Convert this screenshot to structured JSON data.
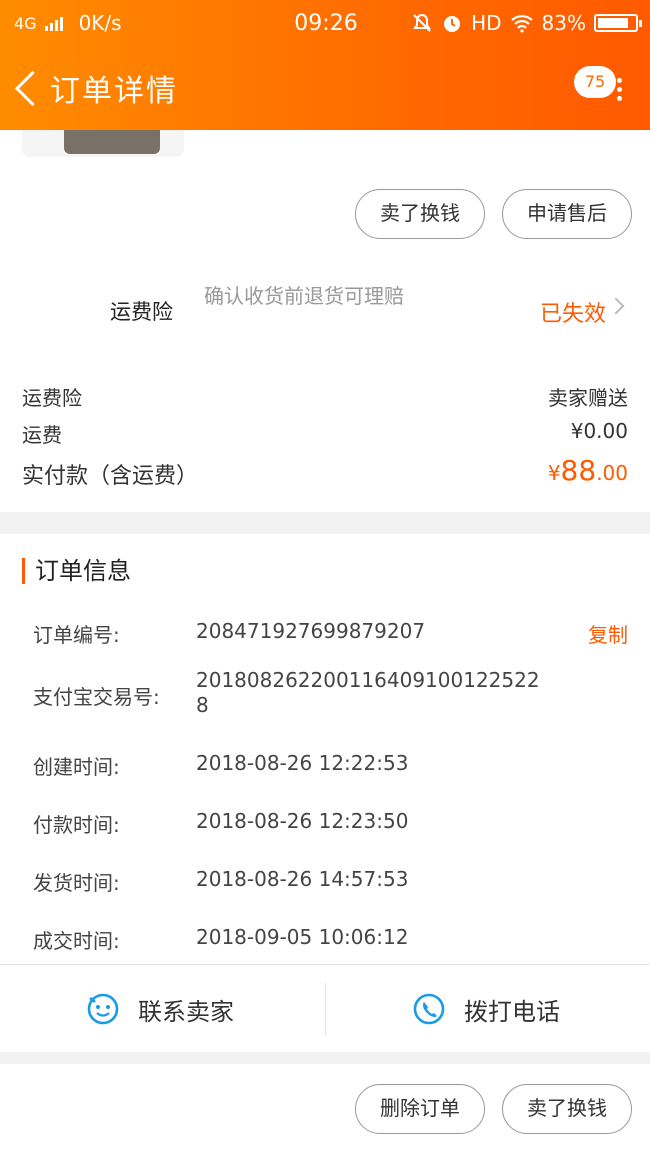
{
  "status_bar": {
    "network": "4G",
    "speed": "0K/s",
    "time": "09:26",
    "hd": "HD",
    "battery": "83%",
    "battery_level": 0.83
  },
  "nav": {
    "title": "订单详情",
    "badge": "75"
  },
  "actions_top": {
    "sell_label": "卖了换钱",
    "after_sale_label": "申请售后"
  },
  "insurance": {
    "name": "运费险",
    "description": "确认收货前退货可理赔",
    "status": "已失效"
  },
  "summary": {
    "insurance_label": "运费险",
    "insurance_value": "卖家赠送",
    "shipping_label": "运费",
    "shipping_value": "¥0.00",
    "total_label": "实付款（含运费）",
    "total_currency": "¥",
    "total_integer": "88",
    "total_decimal": ".00"
  },
  "order_info": {
    "title": "订单信息",
    "copy_label": "复制",
    "rows": [
      {
        "label": "订单编号:",
        "value": "208471927699879207"
      },
      {
        "label": "支付宝交易号:",
        "value": "2018082622001164091001225228"
      },
      {
        "label": "创建时间:",
        "value": "2018-08-26 12:22:53"
      },
      {
        "label": "付款时间:",
        "value": "2018-08-26 12:23:50"
      },
      {
        "label": "发货时间:",
        "value": "2018-08-26 14:57:53"
      },
      {
        "label": "成交时间:",
        "value": "2018-09-05 10:06:12"
      }
    ]
  },
  "contact": {
    "seller_label": "联系卖家",
    "call_label": "拨打电话"
  },
  "actions_bottom": {
    "delete_label": "删除订单",
    "sell_label": "卖了换钱"
  },
  "colors": {
    "accent": "#ff5a00",
    "header_gradient_start": "#ff8c00",
    "header_gradient_end": "#ff5a00",
    "link_blue": "#1a9be8"
  }
}
